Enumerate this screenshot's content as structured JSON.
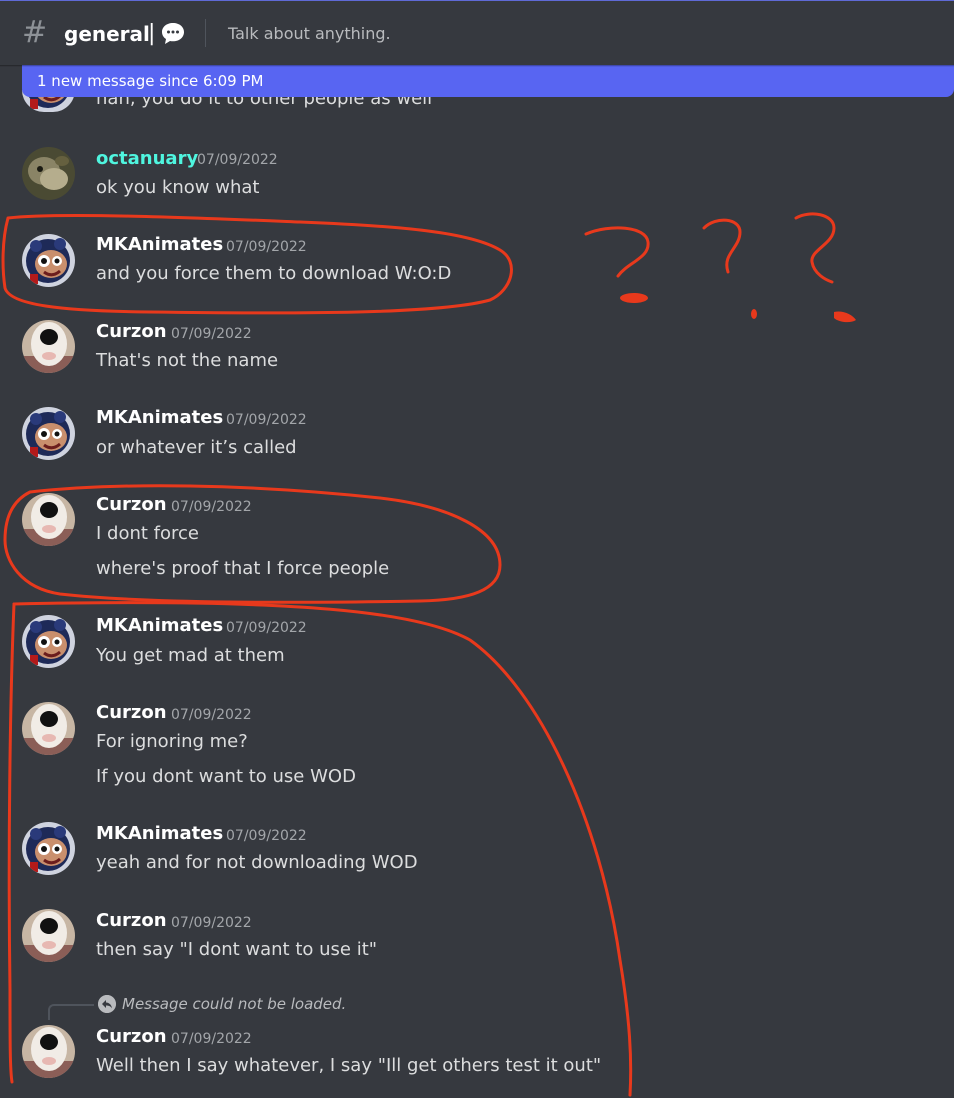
{
  "header": {
    "hash_glyph": "#",
    "channel_name": "general",
    "pipe": "|",
    "topic": "Talk about anything."
  },
  "banner": {
    "text": "1 new message since 6:09 PM"
  },
  "peek": {
    "text": "nah, you do it to other people as well"
  },
  "messages": [
    {
      "username": "octanuary",
      "timestamp": "07/09/2022",
      "lines": [
        "ok you know what"
      ]
    },
    {
      "username": "MKAnimates",
      "timestamp": "07/09/2022",
      "lines": [
        "and you force them to download W:O:D"
      ]
    },
    {
      "username": "Curzon",
      "timestamp": "07/09/2022",
      "lines": [
        "That's not the name"
      ]
    },
    {
      "username": "MKAnimates",
      "timestamp": "07/09/2022",
      "lines": [
        "or whatever it’s called"
      ]
    },
    {
      "username": "Curzon",
      "timestamp": "07/09/2022",
      "lines": [
        "I dont force",
        "where's proof that I force people"
      ]
    },
    {
      "username": "MKAnimates",
      "timestamp": "07/09/2022",
      "lines": [
        "You get mad at them"
      ]
    },
    {
      "username": "Curzon",
      "timestamp": "07/09/2022",
      "lines": [
        "For ignoring me?",
        "If you dont want to use WOD"
      ]
    },
    {
      "username": "MKAnimates",
      "timestamp": "07/09/2022",
      "lines": [
        "yeah and for not downloading WOD"
      ]
    },
    {
      "username": "Curzon",
      "timestamp": "07/09/2022",
      "lines": [
        "then say \"I dont want to use it\""
      ]
    },
    {
      "username": "Curzon",
      "timestamp": "07/09/2022",
      "lines": [
        "Well then I say whatever, I say \"Ill get others test it out\""
      ]
    }
  ],
  "reply": {
    "text": "Message could not be loaded."
  },
  "colors": {
    "background": "#36393f",
    "banner": "#5865f2",
    "username_octanuary": "#4ff5df",
    "annotation_red": "#e8391c"
  },
  "icons": {
    "channel": "hash-icon",
    "threads": "chat-bubble-icon",
    "reply": "reply-arrow-icon"
  }
}
